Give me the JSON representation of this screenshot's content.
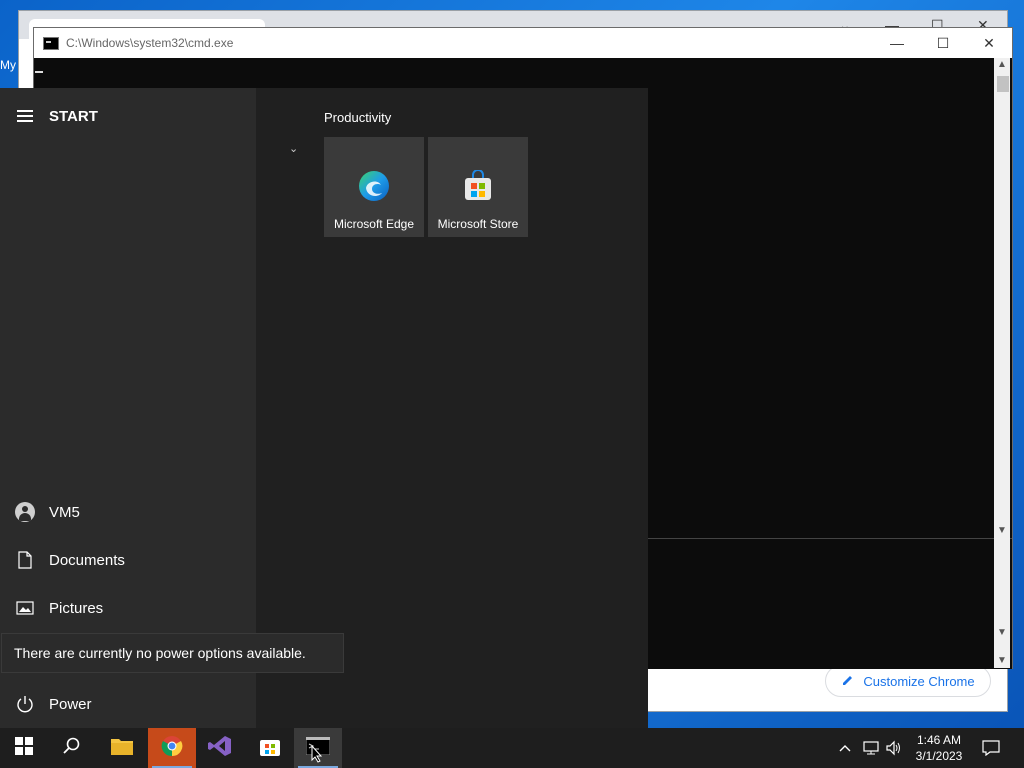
{
  "desktop": {
    "label": "My"
  },
  "chrome": {
    "customize_label": "Customize Chrome",
    "controls": {
      "min": "—",
      "max": "☐",
      "close": "✕"
    }
  },
  "cmd": {
    "title": "C:\\Windows\\system32\\cmd.exe",
    "controls": {
      "min": "—",
      "max": "☐",
      "close": "✕"
    }
  },
  "start_menu": {
    "title": "START",
    "user": "VM5",
    "items": [
      {
        "label": "Documents",
        "icon": "document-icon"
      },
      {
        "label": "Pictures",
        "icon": "pictures-icon"
      },
      {
        "label": "Power",
        "icon": "power-icon"
      }
    ],
    "tooltip": "There are currently no power options available.",
    "group_title": "Productivity",
    "tiles": [
      {
        "label": "Microsoft Edge",
        "icon": "edge-icon"
      },
      {
        "label": "Microsoft Store",
        "icon": "store-icon"
      }
    ]
  },
  "taskbar": {
    "apps": [
      "windows-start-icon",
      "search-icon",
      "file-explorer-icon",
      "chrome-icon",
      "visual-studio-icon",
      "microsoft-store-icon",
      "cmd-icon"
    ],
    "time": "1:46 AM",
    "date": "3/1/2023"
  }
}
